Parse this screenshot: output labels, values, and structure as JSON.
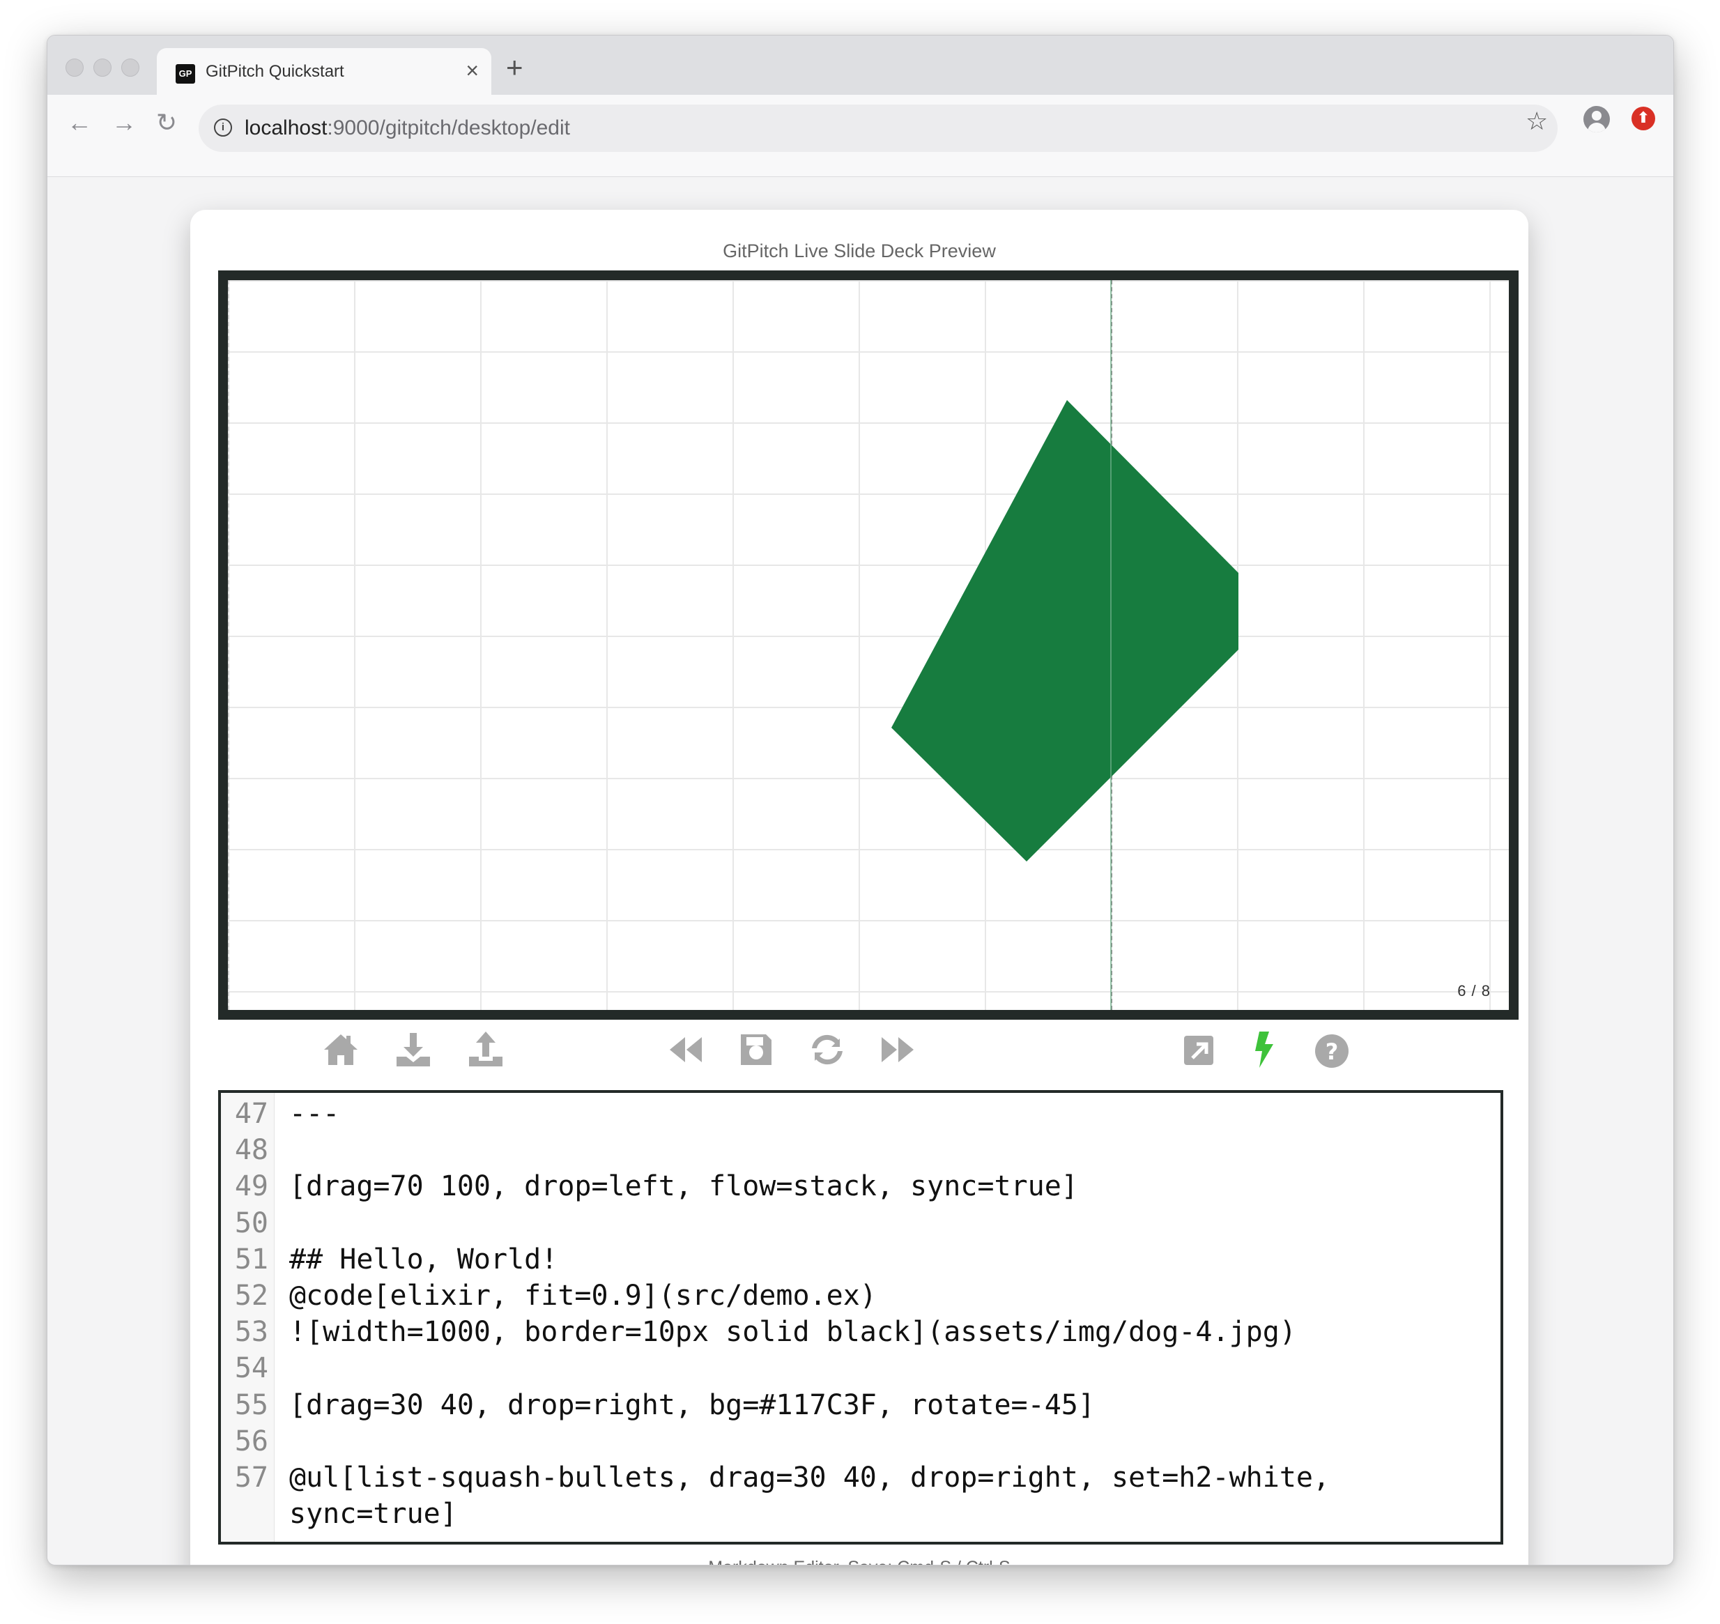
{
  "browser": {
    "tab_title": "GitPitch Quickstart",
    "favicon_text": "GP",
    "close_glyph": "×",
    "newtab_glyph": "+",
    "url_host": "localhost",
    "url_rest": ":9000/gitpitch/desktop/edit",
    "back_glyph": "←",
    "forward_glyph": "→",
    "reload_glyph": "↻",
    "star_glyph": "☆",
    "update_glyph": "⬆",
    "icons": [
      "back-icon",
      "forward-icon",
      "reload-icon",
      "info-icon",
      "star-icon",
      "profile-icon",
      "update-icon"
    ]
  },
  "preview": {
    "title": "GitPitch Live Slide Deck Preview",
    "page_indicator": "6 / 8",
    "shape_color": "#177C3F",
    "frame_color": "#232A28"
  },
  "controls": {
    "left": [
      "home-icon",
      "download-icon",
      "upload-icon"
    ],
    "center": [
      "rewind-icon",
      "save-icon",
      "refresh-icon",
      "fast-forward-icon"
    ],
    "right": [
      "external-link-icon",
      "bolt-icon",
      "help-icon"
    ],
    "icon_color": "#a9a9a9",
    "bolt_color": "#3ec23a"
  },
  "editor": {
    "lines": [
      {
        "no": "47",
        "text": "---"
      },
      {
        "no": "48",
        "text": ""
      },
      {
        "no": "49",
        "text": "[drag=70 100, drop=left, flow=stack, sync=true]"
      },
      {
        "no": "50",
        "text": ""
      },
      {
        "no": "51",
        "text": "## Hello, World!"
      },
      {
        "no": "52",
        "text": "@code[elixir, fit=0.9](src/demo.ex)"
      },
      {
        "no": "53",
        "text": "![width=1000, border=10px solid black](assets/img/dog-4.jpg)"
      },
      {
        "no": "54",
        "text": ""
      },
      {
        "no": "55",
        "text": "[drag=30 40, drop=right, bg=#117C3F, rotate=-45]"
      },
      {
        "no": "56",
        "text": ""
      },
      {
        "no": "57",
        "text": "@ul[list-squash-bullets, drag=30 40, drop=right, set=h2-white,"
      },
      {
        "no": "",
        "text": "sync=true]"
      }
    ],
    "caption": "Markdown Editor, Save: Cmd-S / Ctrl-S"
  }
}
